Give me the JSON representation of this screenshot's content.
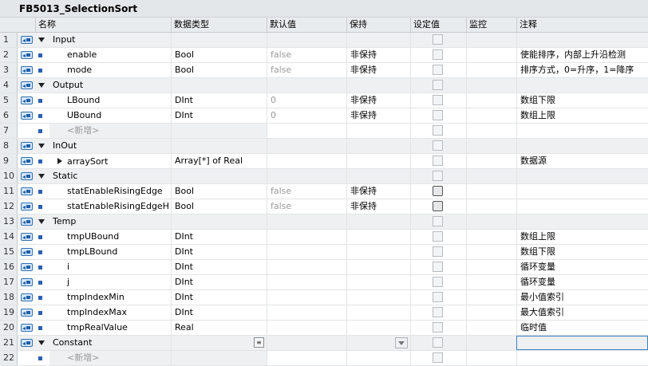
{
  "title": "FB5013_SelectionSort",
  "columns": {
    "name": "名称",
    "type": "数据类型",
    "default": "默认值",
    "retain": "保持",
    "setpoint": "设定值",
    "monitor": "监控",
    "comment": "注释"
  },
  "rows": [
    {
      "num": "1",
      "kind": "section",
      "name": "Input"
    },
    {
      "num": "2",
      "kind": "var",
      "name": "enable",
      "type": "Bool",
      "default": "false",
      "retain": "非保持",
      "comment": "使能排序，内部上升沿检测"
    },
    {
      "num": "3",
      "kind": "var",
      "name": "mode",
      "type": "Bool",
      "default": "false",
      "retain": "非保持",
      "comment": "排序方式，0=升序，1=降序"
    },
    {
      "num": "4",
      "kind": "section",
      "name": "Output"
    },
    {
      "num": "5",
      "kind": "var",
      "name": "LBound",
      "type": "DInt",
      "default": "0",
      "retain": "非保持",
      "comment": "数组下限"
    },
    {
      "num": "6",
      "kind": "var",
      "name": "UBound",
      "type": "DInt",
      "default": "0",
      "retain": "非保持",
      "comment": "数组上限"
    },
    {
      "num": "7",
      "kind": "add",
      "name": "<新增>"
    },
    {
      "num": "8",
      "kind": "section",
      "name": "InOut"
    },
    {
      "num": "9",
      "kind": "struct",
      "name": "arraySort",
      "type": "Array[*] of Real",
      "comment": "数据源"
    },
    {
      "num": "10",
      "kind": "section",
      "name": "Static"
    },
    {
      "num": "11",
      "kind": "var",
      "name": "statEnableRisingEdge",
      "type": "Bool",
      "default": "false",
      "retain": "非保持",
      "setpoint_strong": true
    },
    {
      "num": "12",
      "kind": "var",
      "name": "statEnableRisingEdgeH",
      "type": "Bool",
      "default": "false",
      "retain": "非保持",
      "setpoint_strong": true
    },
    {
      "num": "13",
      "kind": "section",
      "name": "Temp"
    },
    {
      "num": "14",
      "kind": "var",
      "name": "tmpUBound",
      "type": "DInt",
      "comment": "数组上限"
    },
    {
      "num": "15",
      "kind": "var",
      "name": "tmpLBound",
      "type": "DInt",
      "comment": "数组下限"
    },
    {
      "num": "16",
      "kind": "var",
      "name": "i",
      "type": "DInt",
      "comment": "循环变量"
    },
    {
      "num": "17",
      "kind": "var",
      "name": "j",
      "type": "DInt",
      "comment": "循环变量"
    },
    {
      "num": "18",
      "kind": "var",
      "name": "tmpIndexMin",
      "type": "DInt",
      "comment": "最小值索引"
    },
    {
      "num": "19",
      "kind": "var",
      "name": "tmpIndexMax",
      "type": "DInt",
      "comment": "最大值索引"
    },
    {
      "num": "20",
      "kind": "var",
      "name": "tmpRealValue",
      "type": "Real",
      "comment": "临时值"
    },
    {
      "num": "21",
      "kind": "section",
      "name": "Constant",
      "editing": true
    },
    {
      "num": "22",
      "kind": "add",
      "name": "<新增>"
    }
  ]
}
